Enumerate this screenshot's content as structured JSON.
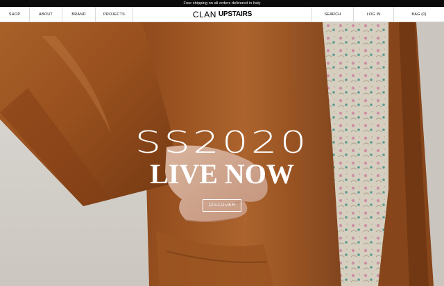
{
  "announcement": "Free shipping on all orders delivered in Italy",
  "nav": {
    "left_items": [
      "SHOP",
      "ABOUT",
      "BRAND",
      "PROJECTS"
    ],
    "logo": {
      "part1": "CLAN",
      "part2": "UPSTAIRS"
    },
    "right_items": [
      "SEARCH",
      "LOG IN",
      "BAG (0)"
    ]
  },
  "hero": {
    "title": "SS2020",
    "subtitle": "LIVE NOW",
    "cta_label": "DISCOVER"
  }
}
